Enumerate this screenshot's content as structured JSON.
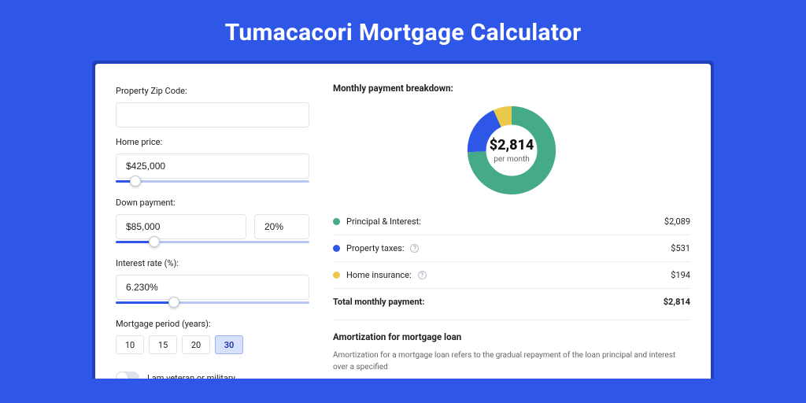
{
  "title": "Tumacacori Mortgage Calculator",
  "form": {
    "zip_label": "Property Zip Code:",
    "zip_value": "",
    "home_price_label": "Home price:",
    "home_price_value": "$425,000",
    "home_price_slider_pct": 10,
    "down_payment_label": "Down payment:",
    "down_payment_value": "$85,000",
    "down_payment_pct_value": "20%",
    "down_payment_slider_pct": 20,
    "interest_label": "Interest rate (%):",
    "interest_value": "6.230%",
    "interest_slider_pct": 30,
    "period_label": "Mortgage period (years):",
    "periods": [
      "10",
      "15",
      "20",
      "30"
    ],
    "period_active_index": 3,
    "veteran_label": "I am veteran or military"
  },
  "result": {
    "breakdown_title": "Monthly payment breakdown:",
    "monthly_total": "$2,814",
    "monthly_total_sub": "per month",
    "rows": [
      {
        "color": "green",
        "label": "Principal & Interest:",
        "has_info": false,
        "value": "$2,089"
      },
      {
        "color": "blue",
        "label": "Property taxes:",
        "has_info": true,
        "value": "$531"
      },
      {
        "color": "yellow",
        "label": "Home insurance:",
        "has_info": true,
        "value": "$194"
      }
    ],
    "total_label": "Total monthly payment:",
    "total_value": "$2,814"
  },
  "amortization": {
    "title": "Amortization for mortgage loan",
    "body": "Amortization for a mortgage loan refers to the gradual repayment of the loan principal and interest over a specified"
  },
  "chart_data": {
    "type": "pie",
    "title": "Monthly payment breakdown",
    "series": [
      {
        "name": "Principal & Interest",
        "value": 2089,
        "color": "#45aa87"
      },
      {
        "name": "Property taxes",
        "value": 531,
        "color": "#2e57e8"
      },
      {
        "name": "Home insurance",
        "value": 194,
        "color": "#eac94b"
      }
    ],
    "total": 2814,
    "center_label": "$2,814 per month"
  }
}
